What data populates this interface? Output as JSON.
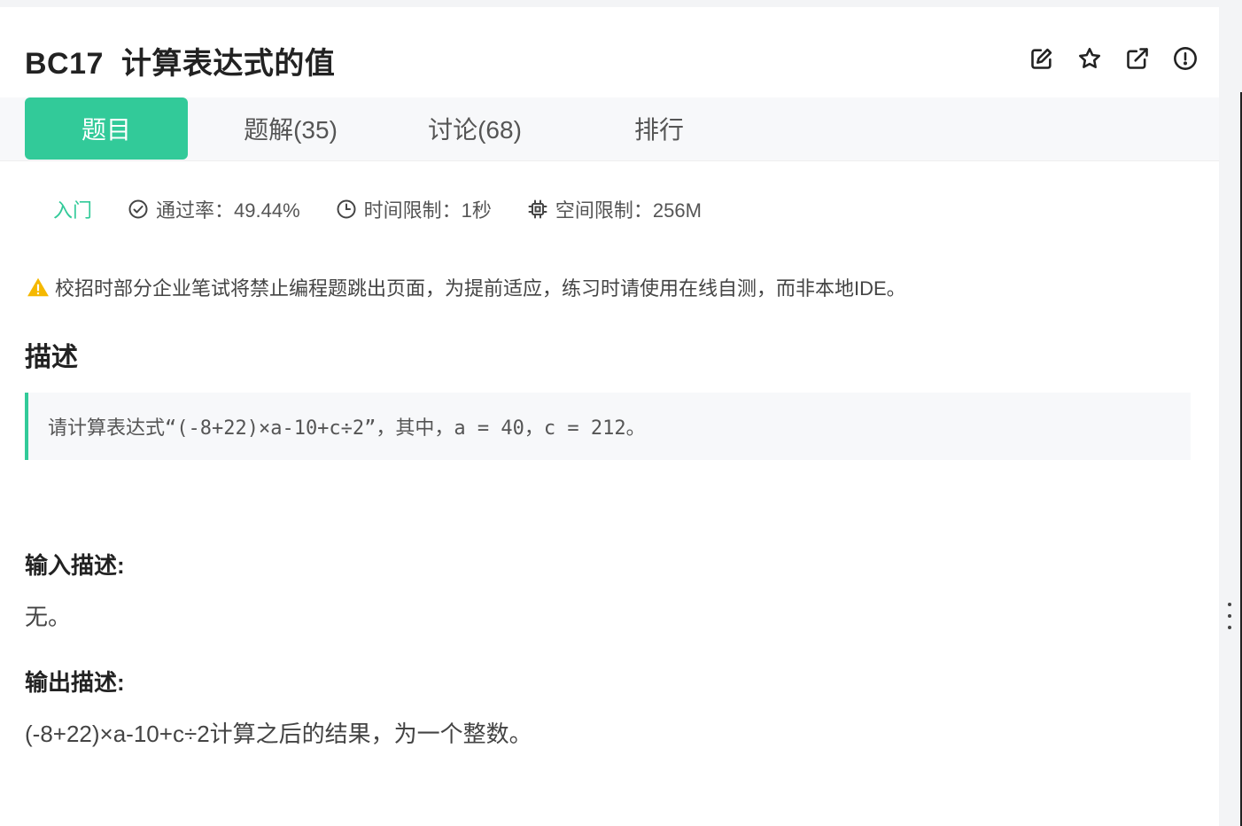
{
  "header": {
    "title": "BC17  计算表达式的值"
  },
  "toolbar": {
    "icons": [
      "edit-icon",
      "star-icon",
      "external-link-icon",
      "alert-circle-icon"
    ]
  },
  "tabs": [
    {
      "label": "题目",
      "active": true
    },
    {
      "label": "题解(35)",
      "active": false
    },
    {
      "label": "讨论(68)",
      "active": false
    },
    {
      "label": "排行",
      "active": false
    }
  ],
  "meta": {
    "level": "入门",
    "pass_rate": "通过率：49.44%",
    "time_limit": "时间限制：1秒",
    "memory_limit": "空间限制：256M"
  },
  "notice": "校招时部分企业笔试将禁止编程题跳出页面，为提前适应，练习时请使用在线自测，而非本地IDE。",
  "description": {
    "heading": "描述",
    "text": "请计算表达式“(-8+22)×a-10+c÷2”，其中，a = 40，c = 212。"
  },
  "input": {
    "heading": "输入描述:",
    "text": "无。"
  },
  "output": {
    "heading": "输出描述:",
    "text": "(-8+22)×a-10+c÷2计算之后的结果，为一个整数。"
  },
  "colors": {
    "accent": "#32ca99",
    "warning": "#f5b800"
  }
}
